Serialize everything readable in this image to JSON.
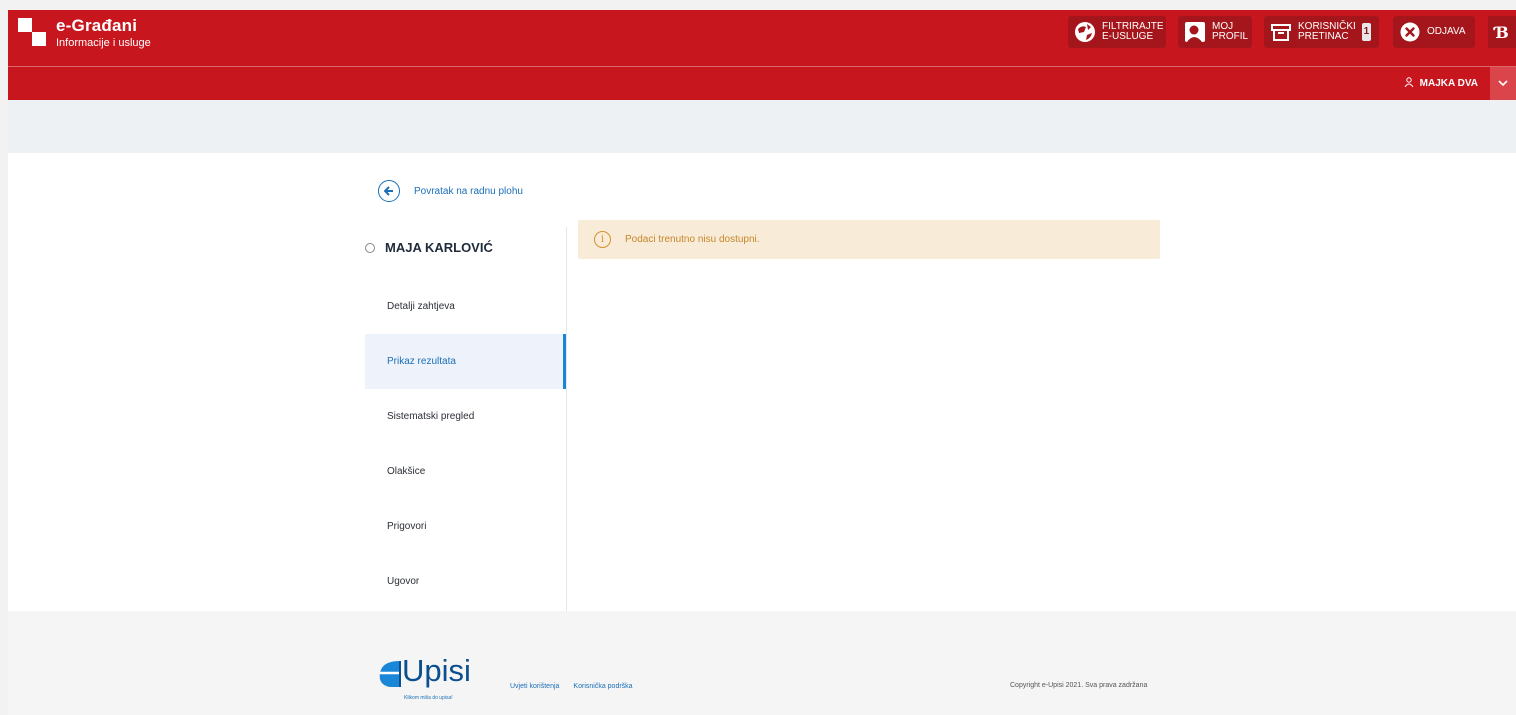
{
  "header": {
    "brand_title": "e-Građani",
    "brand_subtitle": "Informacije i usluge",
    "buttons": {
      "filter": "FILTRIRAJTE\nE-USLUGE",
      "profile": "MOJ\nPROFIL",
      "inbox": "KORISNIČKI\nPRETINAC",
      "inbox_count": "1",
      "logout": "ODJAVA",
      "extra": "Ɓ"
    },
    "user_name": "MAJKA DVA",
    "colors": {
      "primary": "#c8161e",
      "button": "#a5161c"
    }
  },
  "back_link": "Povratak na radnu plohu",
  "student_name": "MAJA KARLOVIĆ",
  "nav": [
    {
      "label": "Detalji zahtjeva",
      "active": false
    },
    {
      "label": "Prikaz rezultata",
      "active": true
    },
    {
      "label": "Sistematski pregled",
      "active": false
    },
    {
      "label": "Olakšice",
      "active": false
    },
    {
      "label": "Prigovori",
      "active": false
    },
    {
      "label": "Ugovor",
      "active": false
    }
  ],
  "alert": {
    "icon": "info-icon",
    "glyph": "i",
    "text": "Podaci trenutno nisu dostupni."
  },
  "footer": {
    "logo_text": "Upisi",
    "logo_tagline": "Klikom miša do upisa!",
    "links": [
      "Uvjeti korištenja",
      "Korisnička podrška"
    ],
    "copyright": "Copyright e-Upisi 2021. Sva prava zadržana"
  }
}
